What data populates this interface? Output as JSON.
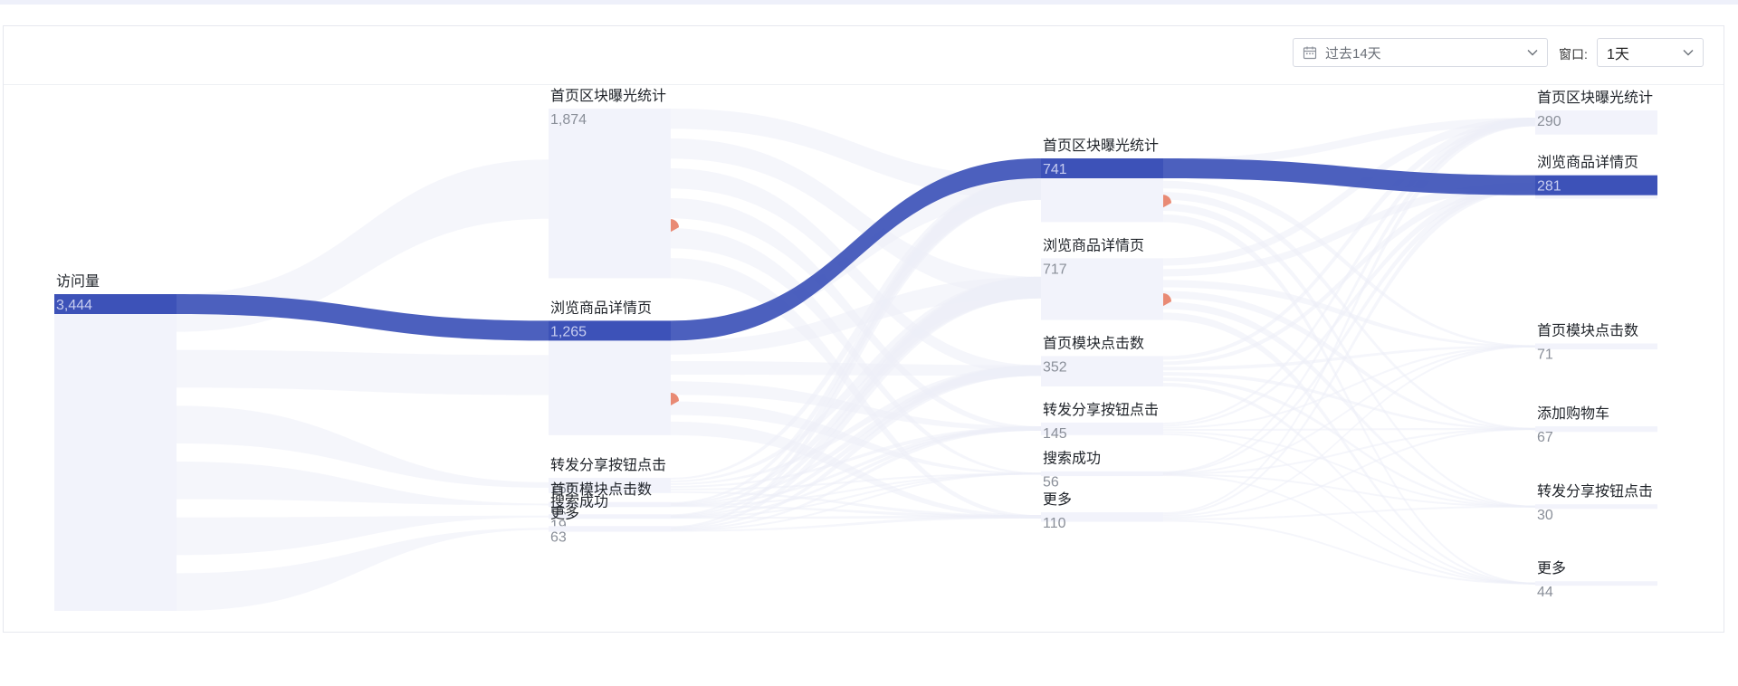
{
  "toolbar": {
    "date_range": "过去14天",
    "window_label": "窗口:",
    "window_value": "1天",
    "calendar_icon": "calendar-icon",
    "dropdown_icon": "chevron-down-icon"
  },
  "colors": {
    "highlight": "#3d52b8",
    "node_fill": "#f2f3fb",
    "link_fill": "#eceef8",
    "drop_marker": "#e98a74"
  },
  "chart_data": {
    "type": "sankey",
    "columns": [
      {
        "nodes": [
          {
            "id": "c0n0",
            "name": "访问量",
            "value": "3,444",
            "highlight": true
          }
        ]
      },
      {
        "nodes": [
          {
            "id": "c1n0",
            "name": "首页区块曝光统计",
            "value": "1,874",
            "drop": true
          },
          {
            "id": "c1n1",
            "name": "浏览商品详情页",
            "value": "1,265",
            "highlight": true,
            "drop": true
          },
          {
            "id": "c1n2",
            "name": "转发分享按钮点击",
            "value": "169"
          },
          {
            "id": "c1n3",
            "name": "首页模块点击数",
            "value": "55"
          },
          {
            "id": "c1n4",
            "name": "搜索成功",
            "value": "19"
          },
          {
            "id": "c1n5",
            "name": "更多",
            "value": "63"
          }
        ]
      },
      {
        "nodes": [
          {
            "id": "c2n0",
            "name": "首页区块曝光统计",
            "value": "741",
            "highlight": true,
            "drop": true
          },
          {
            "id": "c2n1",
            "name": "浏览商品详情页",
            "value": "717",
            "drop": true
          },
          {
            "id": "c2n2",
            "name": "首页模块点击数",
            "value": "352"
          },
          {
            "id": "c2n3",
            "name": "转发分享按钮点击",
            "value": "145"
          },
          {
            "id": "c2n4",
            "name": "搜索成功",
            "value": "56"
          },
          {
            "id": "c2n5",
            "name": "更多",
            "value": "110"
          }
        ]
      },
      {
        "nodes": [
          {
            "id": "c3n0",
            "name": "首页区块曝光统计",
            "value": "290"
          },
          {
            "id": "c3n1",
            "name": "浏览商品详情页",
            "value": "281",
            "highlight": true
          },
          {
            "id": "c3n2",
            "name": "首页模块点击数",
            "value": "71"
          },
          {
            "id": "c3n3",
            "name": "添加购物车",
            "value": "67"
          },
          {
            "id": "c3n4",
            "name": "转发分享按钮点击",
            "value": "30"
          },
          {
            "id": "c3n5",
            "name": "更多",
            "value": "44"
          }
        ]
      }
    ],
    "highlight_path": [
      "c0n0",
      "c1n1",
      "c2n0",
      "c3n1"
    ]
  }
}
